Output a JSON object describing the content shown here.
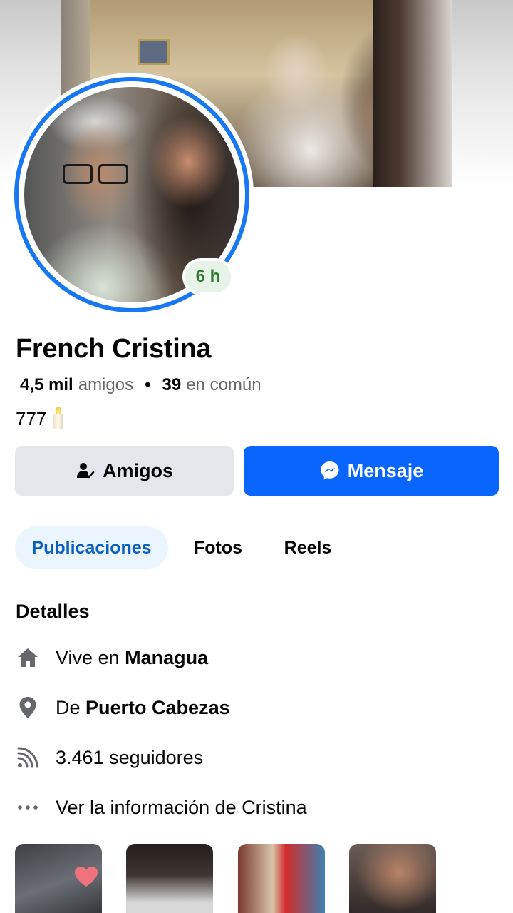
{
  "profile": {
    "name": "French Cristina",
    "friends_count": "4,5 mil",
    "friends_label": "amigos",
    "mutual_count": "39",
    "mutual_label": "en común",
    "bio": "777",
    "story_age": "6 h"
  },
  "actions": {
    "friends_button": "Amigos",
    "message_button": "Mensaje"
  },
  "tabs": [
    {
      "label": "Publicaciones",
      "active": true
    },
    {
      "label": "Fotos",
      "active": false
    },
    {
      "label": "Reels",
      "active": false
    }
  ],
  "details": {
    "title": "Detalles",
    "lives_prefix": "Vive en",
    "lives_city": "Managua",
    "from_prefix": "De",
    "from_city": "Puerto Cabezas",
    "followers": "3.461 seguidores",
    "see_more": "Ver la información de Cristina"
  },
  "icons": {
    "lives": "home-icon",
    "from": "location-pin-icon",
    "followers": "rss-feed-icon",
    "more": "more-dots-icon",
    "friends": "friend-check-icon",
    "message": "messenger-icon",
    "bio_emoji": "candle-icon"
  },
  "colors": {
    "accent": "#0866ff",
    "ring": "#1877f2",
    "active_tab_bg": "#ebf5ff",
    "active_tab_text": "#0b5fbf",
    "secondary_button": "#e4e6eb",
    "muted_text": "#65676b",
    "story_badge_text": "#2f7d32"
  }
}
